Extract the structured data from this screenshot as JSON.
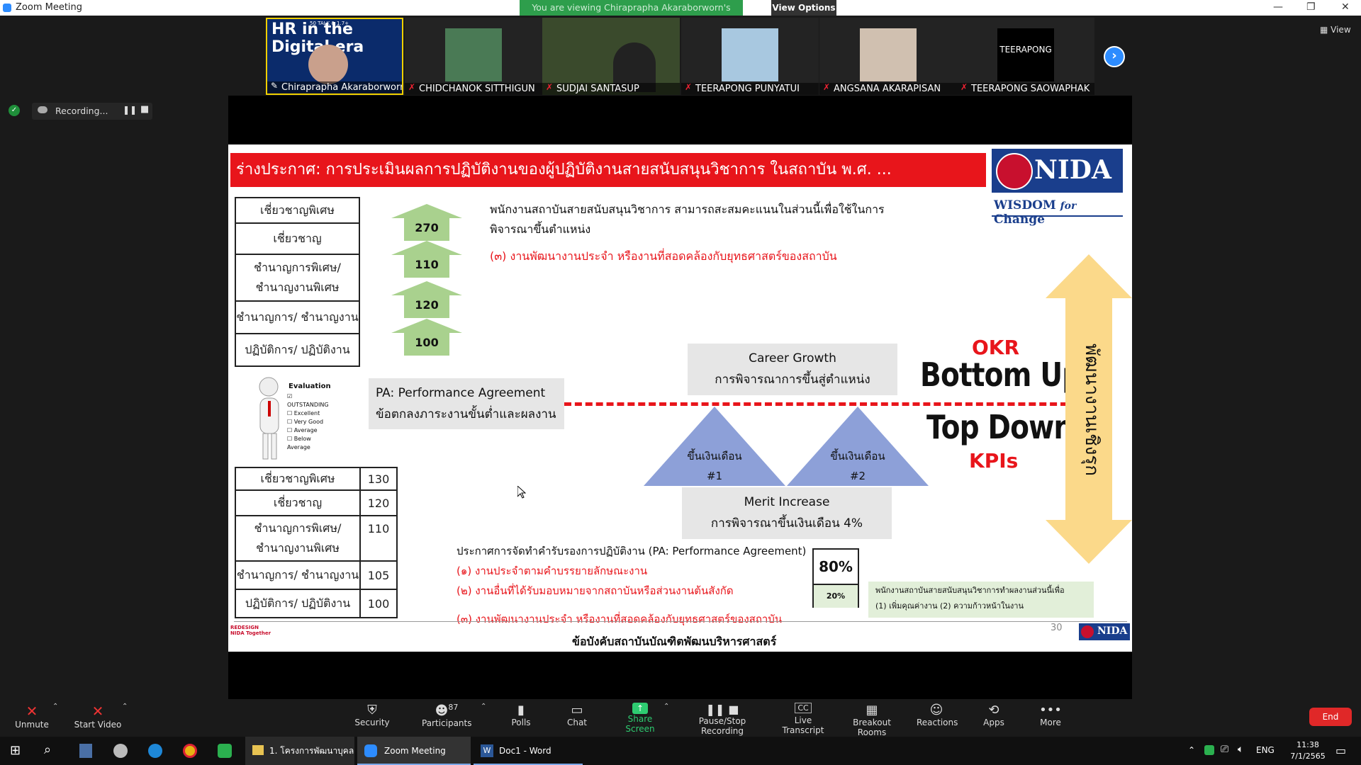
{
  "window": {
    "title": "Zoom Meeting",
    "viewing_banner": "You are viewing Chiraprapha Akaraborworn's screen",
    "view_options": "View Options",
    "side_view": "View",
    "recording": "Recording..."
  },
  "participants": [
    {
      "name": "Chiraprapha Akaraborworn",
      "tile_text": "HR in the Digital era",
      "tile_badge": "50 TALK & 1.7+"
    },
    {
      "name": "CHIDCHANOK SITTHIGUN"
    },
    {
      "name": "SUDJAI SANTASUP"
    },
    {
      "name": "TEERAPONG PUNYATUI"
    },
    {
      "name": "ANGSANA AKARAPISAN"
    },
    {
      "name": "TEERAPONG SAOWAPHAK",
      "tile_text": "TEERAPONG"
    }
  ],
  "slide": {
    "title": "ร่างประกาศ: การประเมินผลการปฏิบัติงานของผู้ปฏิบัติงานสายสนับสนุนวิชาการ ในสถาบัน พ.ศ. ...",
    "logo_nida": "NIDA",
    "logo_tagline_1": "WISDOM",
    "logo_tagline_2": "for",
    "logo_tagline_3": "Change",
    "top_levels": [
      "เชี่ยวชาญพิเศษ",
      "เชี่ยวชาญ",
      "ชำนาญการพิเศษ/ ชำนาญงานพิเศษ",
      "ชำนาญการ/ ชำนาญงาน",
      "ปฏิบัติการ/ ปฏิบัติงาน"
    ],
    "arrows": [
      "270",
      "110",
      "120",
      "100"
    ],
    "intro_text": "พนักงานสถาบันสายสนับสนุนวิชาการ สามารถสะสมคะแนนในส่วนนี้เพื่อใช้ในการพิจารณาขึ้นตำแหน่ง",
    "item3_top": "(๓) งานพัฒนางานประจำ หรืองานที่สอดคล้องกับยุทธศาสตร์ของสถาบัน",
    "eval_title": "Evaluation",
    "eval_options": [
      "OUTSTANDING",
      "Excellent",
      "Very Good",
      "Average",
      "Below Average"
    ],
    "pa_line1": "PA: Performance Agreement",
    "pa_line2": "ข้อตกลงภาระงานขั้นต่ำและผลงาน",
    "career_line1": "Career Growth",
    "career_line2": "การพิจารณาการขึ้นสู่ตำแหน่ง",
    "tri1_line1": "ขึ้นเงินเดือน",
    "tri1_line2": "#1",
    "tri2_line1": "ขึ้นเงินเดือน",
    "tri2_line2": "#2",
    "merit_line1": "Merit Increase",
    "merit_line2": "การพิจารณาขึ้นเงินเดือน 4%",
    "okr": "OKR",
    "bottom_up": "Bottom Up",
    "top_down": "Top Down",
    "kpis": "KPIs",
    "vertical_text": "พัฒนางานเชิงรุก",
    "bottom_levels": [
      {
        "label": "เชี่ยวชาญพิเศษ",
        "value": "130"
      },
      {
        "label": "เชี่ยวชาญ",
        "value": "120"
      },
      {
        "label": "ชำนาญการพิเศษ/ ชำนาญงานพิเศษ",
        "value": "110"
      },
      {
        "label": "ชำนาญการ/ ชำนาญงาน",
        "value": "105"
      },
      {
        "label": "ปฏิบัติการ/ ปฏิบัติงาน",
        "value": "100"
      }
    ],
    "announce_title": "ประกาศการจัดทำคำรับรองการปฏิบัติงาน (PA: Performance Agreement)",
    "announce_items": [
      "(๑) งานประจำตามคำบรรยายลักษณะงาน",
      "(๒) งานอื่นที่ได้รับมอบหมายจากสถาบันหรือส่วนงานต้นสังกัด",
      "(๓) งานพัฒนางานประจำ หรืองานที่สอดคล้องกับยุทธศาสตร์ของสถาบัน"
    ],
    "pct_80": "80%",
    "pct_20": "20%",
    "green_note_1": "พนักงานสถาบันสายสนับสนุนวิชาการทำผลงานส่วนนี้เพื่อ",
    "green_note_2": "(1) เพิ่มคุณค่างาน (2) ความก้าวหน้าในงาน",
    "page_number": "30",
    "footer": "ข้อบังคับสถาบันบัณฑิตพัฒนบริหารศาสตร์",
    "redesign_text": "REDESIGN NIDA Together"
  },
  "toolbar": {
    "unmute": "Unmute",
    "start_video": "Start Video",
    "security": "Security",
    "participants": "Participants",
    "participants_count": "87",
    "polls": "Polls",
    "chat": "Chat",
    "share_screen": "Share Screen",
    "record": "Pause/Stop Recording",
    "transcript": "Live Transcript",
    "breakout": "Breakout Rooms",
    "reactions": "Reactions",
    "apps": "Apps",
    "more": "More",
    "end": "End"
  },
  "taskbar": {
    "items": [
      "1. โครงการพัฒนาบุคล...",
      "Zoom Meeting",
      "Doc1 - Word"
    ],
    "lang": "ENG",
    "time": "11:38",
    "date": "7/1/2565"
  },
  "colors": {
    "accent": "#2d8cff",
    "slide_red": "#e8151b",
    "nida_blue": "#1a3e8c",
    "share_green": "#2e9e4c"
  }
}
